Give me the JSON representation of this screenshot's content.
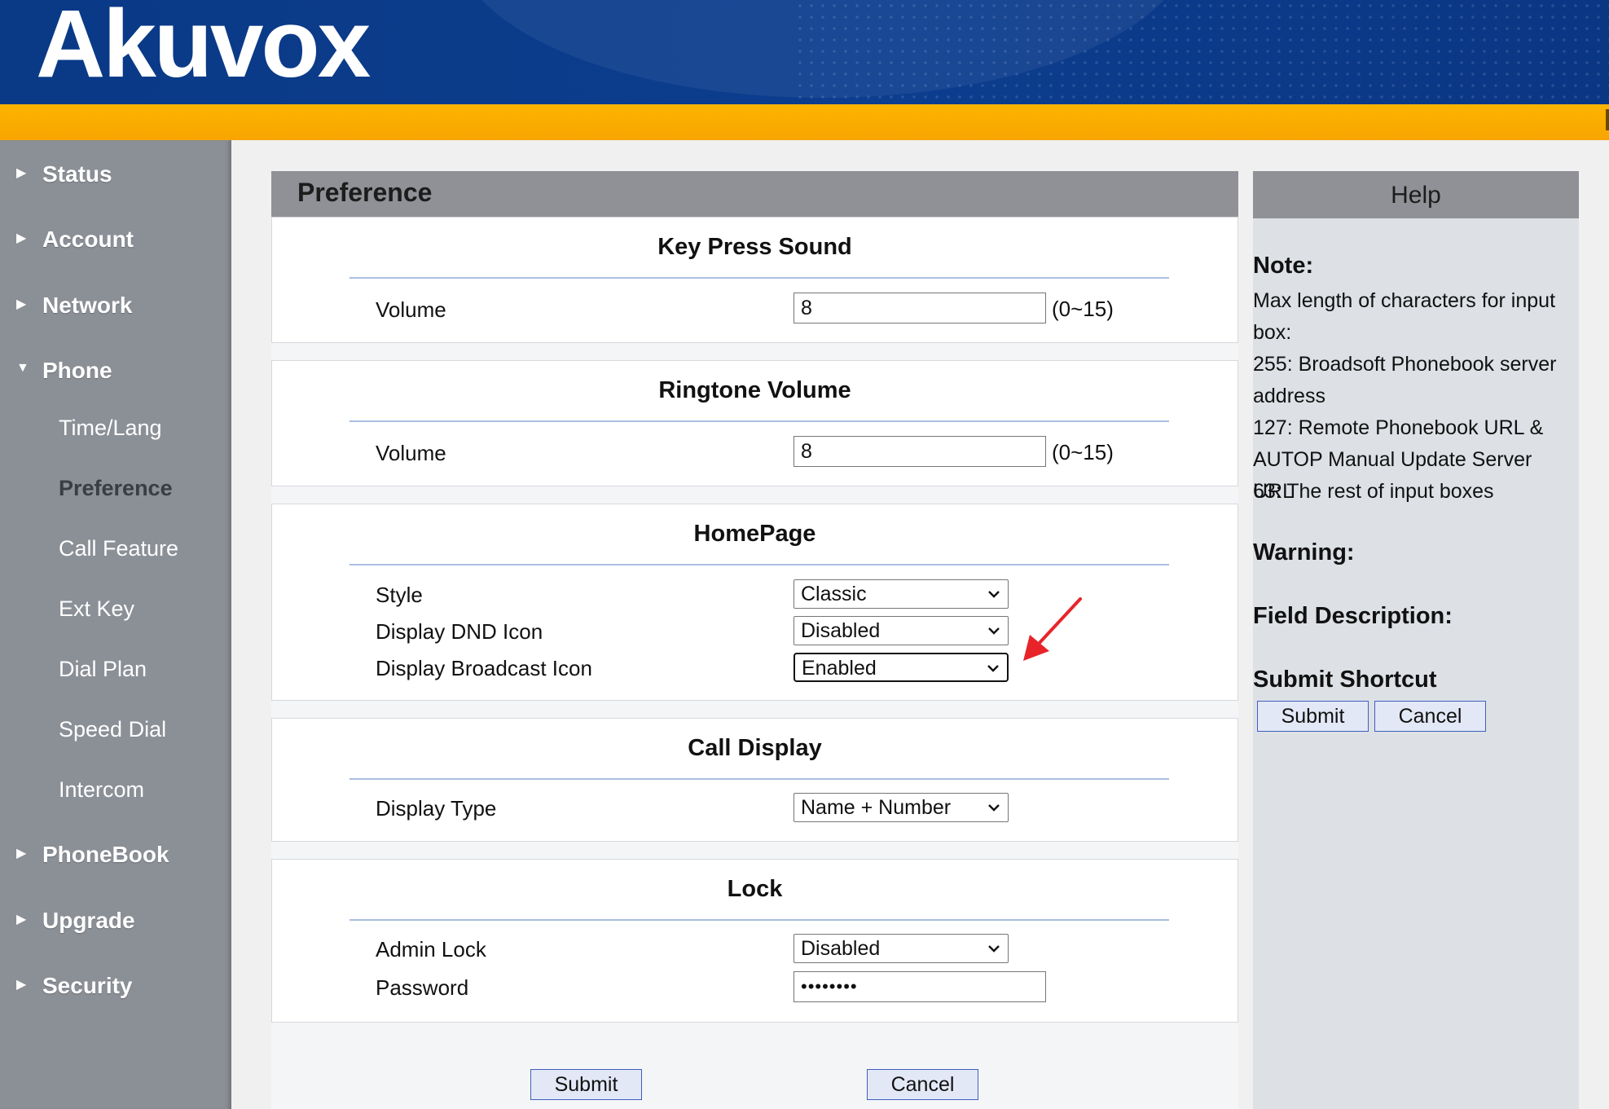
{
  "brand": {
    "logo_text": "Akuvox"
  },
  "sidebar": {
    "items": [
      {
        "label": "Status"
      },
      {
        "label": "Account"
      },
      {
        "label": "Network"
      },
      {
        "label": "Phone"
      },
      {
        "label": "PhoneBook"
      },
      {
        "label": "Upgrade"
      },
      {
        "label": "Security"
      }
    ],
    "phone_sub": [
      {
        "label": "Time/Lang"
      },
      {
        "label": "Preference"
      },
      {
        "label": "Call Feature"
      },
      {
        "label": "Ext Key"
      },
      {
        "label": "Dial Plan"
      },
      {
        "label": "Speed Dial"
      },
      {
        "label": "Intercom"
      }
    ],
    "active_sub": "Preference"
  },
  "main": {
    "title": "Preference",
    "key_press_sound": {
      "title": "Key Press Sound",
      "volume_label": "Volume",
      "volume_value": "8",
      "range": "(0~15)"
    },
    "ringtone_volume": {
      "title": "Ringtone Volume",
      "volume_label": "Volume",
      "volume_value": "8",
      "range": "(0~15)"
    },
    "homepage": {
      "title": "HomePage",
      "style_label": "Style",
      "style_value": "Classic",
      "dnd_label": "Display DND Icon",
      "dnd_value": "Disabled",
      "broadcast_label": "Display Broadcast Icon",
      "broadcast_value": "Enabled"
    },
    "call_display": {
      "title": "Call Display",
      "type_label": "Display Type",
      "type_value": "Name + Number"
    },
    "lock": {
      "title": "Lock",
      "admin_label": "Admin Lock",
      "admin_value": "Disabled",
      "password_label": "Password",
      "password_value": "••••••••"
    },
    "submit_label": "Submit",
    "cancel_label": "Cancel"
  },
  "help": {
    "title": "Help",
    "note_heading": "Note:",
    "note_lines": [
      "Max length of characters for input box:",
      "255: Broadsoft Phonebook server address",
      "127: Remote Phonebook URL & AUTOP Manual Update Server URL",
      "63: The rest of input boxes"
    ],
    "warning_heading": "Warning:",
    "field_desc_heading": "Field Description:",
    "shortcut_heading": "Submit Shortcut",
    "submit_label": "Submit",
    "cancel_label": "Cancel"
  },
  "colors": {
    "header_blue": "#0c3d8e",
    "accent_orange": "#ffb400",
    "sidebar_gray": "#8b8f96",
    "annotation_red": "#e8242a"
  }
}
